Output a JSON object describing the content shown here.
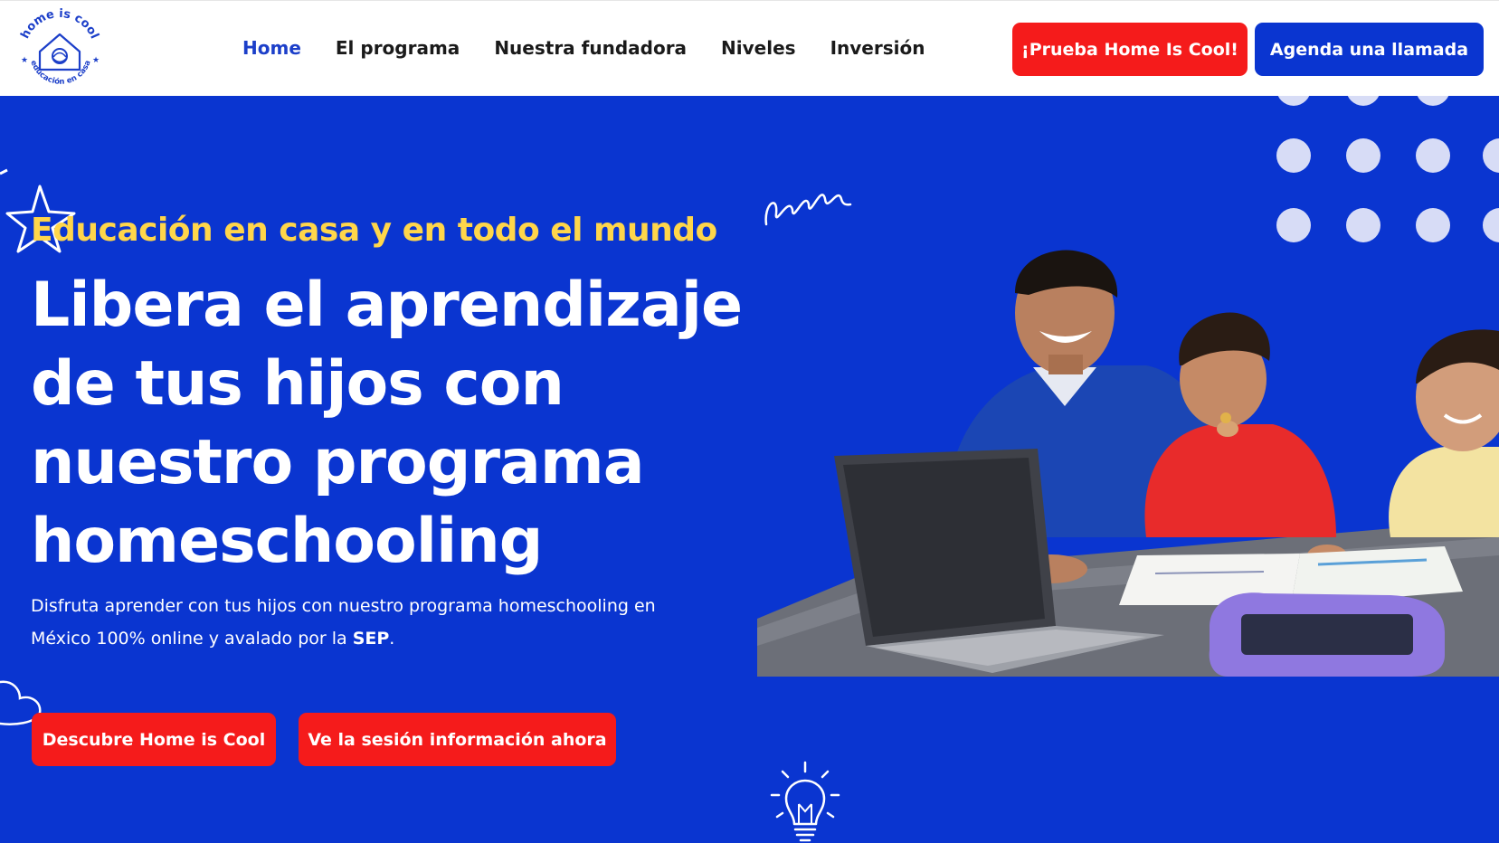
{
  "brand": {
    "logo_text_top": "home is cool",
    "logo_text_bottom": "educación en casa",
    "accent_blue": "#0a35d0",
    "accent_red": "#f51b1b",
    "accent_yellow": "#ffd64a"
  },
  "nav": {
    "items": [
      {
        "label": "Home",
        "active": true
      },
      {
        "label": "El programa",
        "active": false
      },
      {
        "label": "Nuestra fundadora",
        "active": false
      },
      {
        "label": "Niveles",
        "active": false
      },
      {
        "label": "Inversión",
        "active": false
      }
    ],
    "cta_try": "¡Prueba Home Is Cool!",
    "cta_call": "Agenda una llamada"
  },
  "hero": {
    "kicker": "Educación en casa y en todo el mundo",
    "headline_lines": [
      "Libera el aprendizaje",
      "de tus hijos con",
      "nuestro programa",
      "homeschooling"
    ],
    "description_part1": "Disfruta aprender con tus hijos con nuestro programa homeschooling en México 100% online y avalado por la ",
    "description_bold": "SEP",
    "description_end": ".",
    "btn_discover": "Descubre Home is Cool",
    "btn_session": "Ve la sesión información ahora"
  },
  "icons": [
    "home-logo-icon",
    "star-doodle-icon",
    "loops-doodle-icon",
    "cloud-doodle-icon",
    "lightbulb-doodle-icon",
    "dot-grid-decoration"
  ]
}
